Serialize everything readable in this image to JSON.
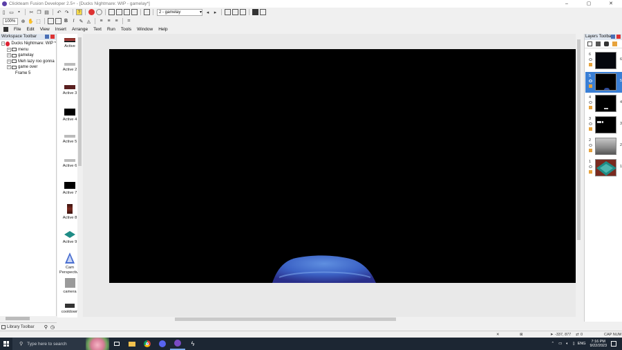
{
  "window": {
    "title": "Clickteam Fusion Developer 2.5+ - [Ducks Nightmare: WIP - gamelay*]",
    "controls": [
      "–",
      "▢",
      "✕"
    ]
  },
  "toolbar": {
    "frame_select": "2 - gamelay",
    "zoom": "100%"
  },
  "menu": [
    "File",
    "Edit",
    "View",
    "Insert",
    "Arrange",
    "Text",
    "Run",
    "Tools",
    "Window",
    "Help"
  ],
  "workspace": {
    "header": "Workspace Toolbar",
    "project": "Ducks Nightmare: WIP *",
    "frames": [
      "menu",
      "gamelay",
      "Meh lazy roo gonna",
      "game over",
      "Frame 5"
    ]
  },
  "library": {
    "label": "Library Toolbar"
  },
  "objects": [
    {
      "label": "Active"
    },
    {
      "label": "Active 2"
    },
    {
      "label": "Active 3"
    },
    {
      "label": "Active 4"
    },
    {
      "label": "Active 5"
    },
    {
      "label": "Active 6"
    },
    {
      "label": "Active 7"
    },
    {
      "label": "Active 8"
    },
    {
      "label": "Active 9"
    },
    {
      "label": "Cam Perspective"
    },
    {
      "label": "camera"
    },
    {
      "label": "cooldown"
    }
  ],
  "layers": {
    "header": "Layers Toolbar",
    "items": [
      {
        "num": "6"
      },
      {
        "num": "5"
      },
      {
        "num": "4"
      },
      {
        "num": "3"
      },
      {
        "num": "2"
      },
      {
        "num": "1"
      }
    ]
  },
  "status": {
    "coords": "-337, 877",
    "count": "0",
    "caps": "CAP NUM"
  },
  "taskbar": {
    "search_placeholder": "Type here to search",
    "time": "7:16 PM",
    "date": "9/22/2023",
    "lang": "ENG"
  },
  "colors": {
    "canvas": "#000000",
    "editor_bg": "#e9e9e9",
    "selected_layer": "#3a7fd5",
    "taskbar": "#1c2633"
  }
}
